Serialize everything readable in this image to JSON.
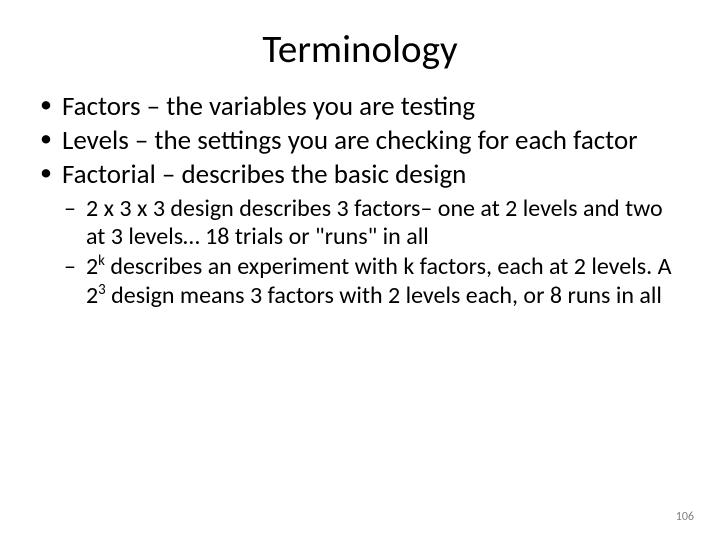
{
  "title": "Terminology",
  "bullets": {
    "b1": "Factors – the variables you are testing",
    "b2": "Levels – the settings you are checking for each factor",
    "b3": "Factorial – describes the basic design",
    "s1": "2 x 3 x 3 design describes 3 factors– one at 2 levels and two at 3 levels… 18 trials or \"runs\" in all",
    "s2a": "2",
    "s2b": "k",
    "s2c": " describes an experiment with k factors, each at 2 levels.  A 2",
    "s2d": "3",
    "s2e": " design means 3 factors with 2 levels each, or 8 runs in all"
  },
  "page": "106"
}
